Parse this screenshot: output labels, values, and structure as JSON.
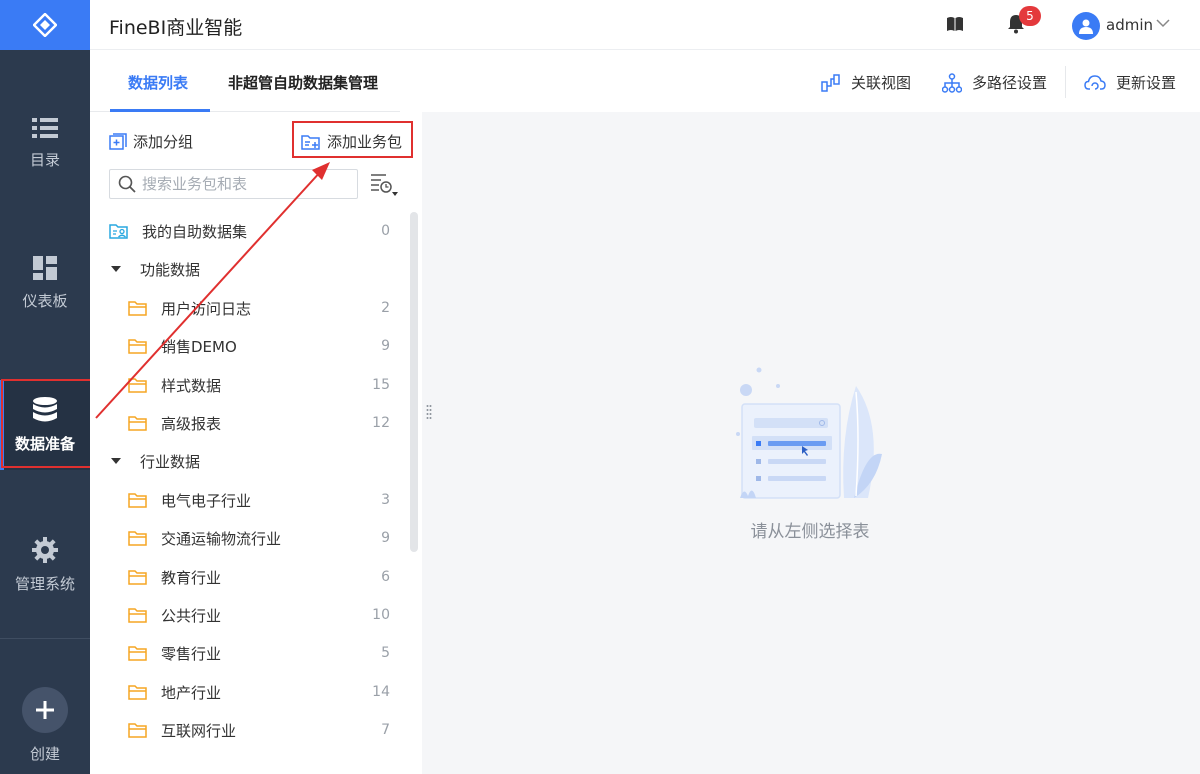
{
  "app": {
    "title": "FineBI商业智能"
  },
  "nav": {
    "items": [
      {
        "label": "目录",
        "icon": "list-icon"
      },
      {
        "label": "仪表板",
        "icon": "dashboard-icon"
      },
      {
        "label": "数据准备",
        "icon": "database-icon",
        "active": true
      },
      {
        "label": "管理系统",
        "icon": "gear-icon"
      }
    ],
    "create_label": "创建"
  },
  "header": {
    "notification_count": "5",
    "username": "admin"
  },
  "tabs": [
    {
      "label": "数据列表",
      "active": true
    },
    {
      "label": "非超管自助数据集管理",
      "active": false
    }
  ],
  "toolbar": {
    "relation_view": "关联视图",
    "multipath": "多路径设置",
    "update_settings": "更新设置"
  },
  "panel": {
    "add_group": "添加分组",
    "add_package": "添加业务包",
    "search_placeholder": "搜索业务包和表",
    "my_dataset": {
      "label": "我的自助数据集",
      "count": "0"
    },
    "groups": [
      {
        "label": "功能数据",
        "items": [
          {
            "label": "用户访问日志",
            "count": "2"
          },
          {
            "label": "销售DEMO",
            "count": "9"
          },
          {
            "label": "样式数据",
            "count": "15"
          },
          {
            "label": "高级报表",
            "count": "12"
          }
        ]
      },
      {
        "label": "行业数据",
        "items": [
          {
            "label": "电气电子行业",
            "count": "3"
          },
          {
            "label": "交通运输物流行业",
            "count": "9"
          },
          {
            "label": "教育行业",
            "count": "6"
          },
          {
            "label": "公共行业",
            "count": "10"
          },
          {
            "label": "零售行业",
            "count": "5"
          },
          {
            "label": "地产行业",
            "count": "14"
          },
          {
            "label": "互联网行业",
            "count": "7"
          }
        ]
      }
    ]
  },
  "empty_state": {
    "text": "请从左侧选择表"
  },
  "colors": {
    "accent": "#3a7bf5",
    "nav_bg": "#2c3a4e",
    "highlight": "#e0302f",
    "folder": "#f5a623"
  }
}
